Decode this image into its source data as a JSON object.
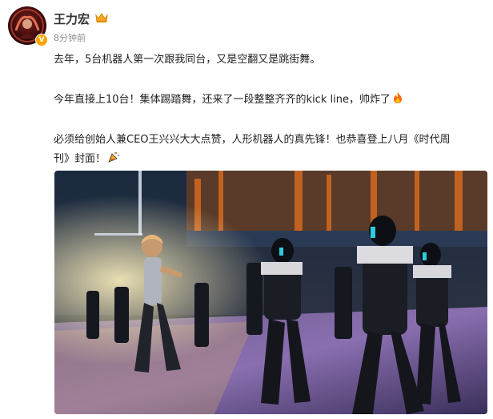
{
  "author": {
    "name": "王力宏",
    "time": "8分钟前",
    "verified_icon": "v-badge-icon",
    "member_icon": "crown-member-icon"
  },
  "post": {
    "line1": "去年，5台机器人第一次跟我同台，又是空翻又是跳街舞。",
    "line2": "今年直接上10台！集体踢踏舞，还来了一段整整齐齐的kick line，帅炸了",
    "line2_emoji": "fire-icon",
    "line3": "必须给创始人兼CEO王兴兴大大点赞，人形机器人的真先锋！也恭喜登上八月《时代周",
    "line4": "刊》封面！",
    "line4_emoji": "party-popper-icon"
  },
  "colors": {
    "badge": "#f7a500",
    "text": "#222222",
    "muted": "#8a8a8a"
  }
}
